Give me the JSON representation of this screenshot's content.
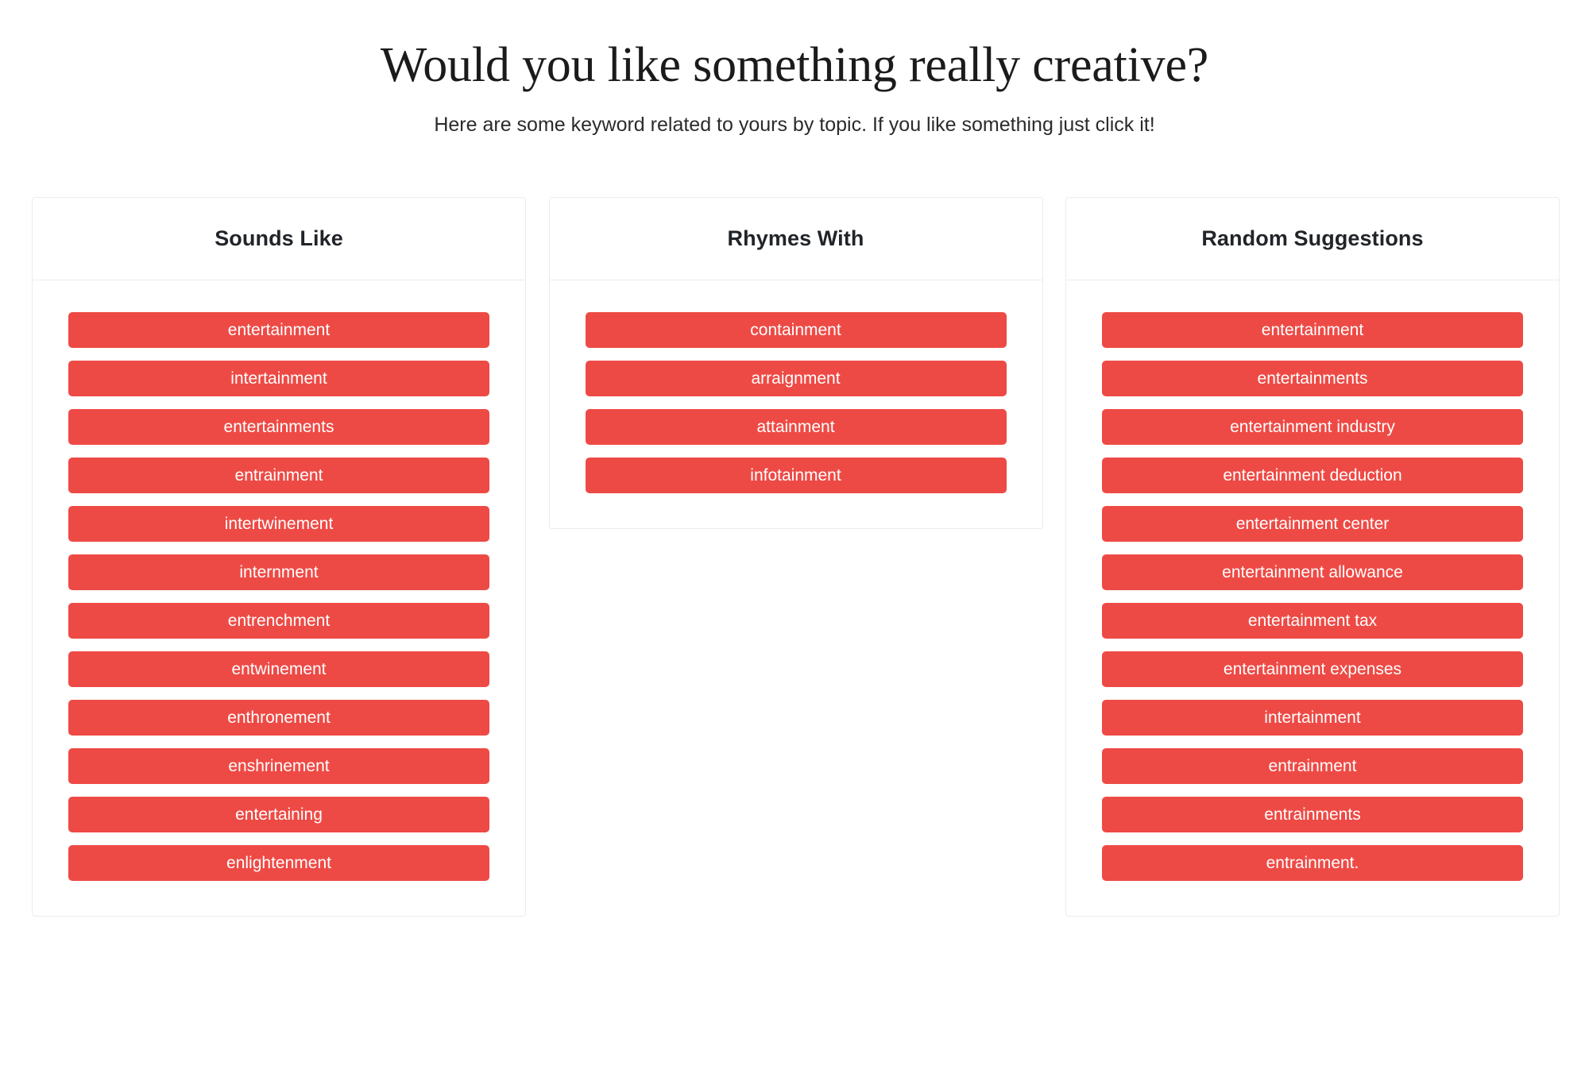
{
  "header": {
    "title": "Would you like something really creative?",
    "subtitle": "Here are some keyword related to yours by topic. If you like something just click it!"
  },
  "theme": {
    "button_color": "#ee4a45",
    "button_text_color": "#ffffff",
    "page_background": "#ffffff",
    "card_border_color": "#ececec",
    "title_color": "#1b1b1b"
  },
  "columns": [
    {
      "title": "Sounds Like",
      "items": [
        "entertainment",
        "intertainment",
        "entertainments",
        "entrainment",
        "intertwinement",
        "internment",
        "entrenchment",
        "entwinement",
        "enthronement",
        "enshrinement",
        "entertaining",
        "enlightenment"
      ]
    },
    {
      "title": "Rhymes With",
      "items": [
        "containment",
        "arraignment",
        "attainment",
        "infotainment"
      ]
    },
    {
      "title": "Random Suggestions",
      "items": [
        "entertainment",
        "entertainments",
        "entertainment industry",
        "entertainment deduction",
        "entertainment center",
        "entertainment allowance",
        "entertainment tax",
        "entertainment expenses",
        "intertainment",
        "entrainment",
        "entrainments",
        "entrainment."
      ]
    }
  ]
}
